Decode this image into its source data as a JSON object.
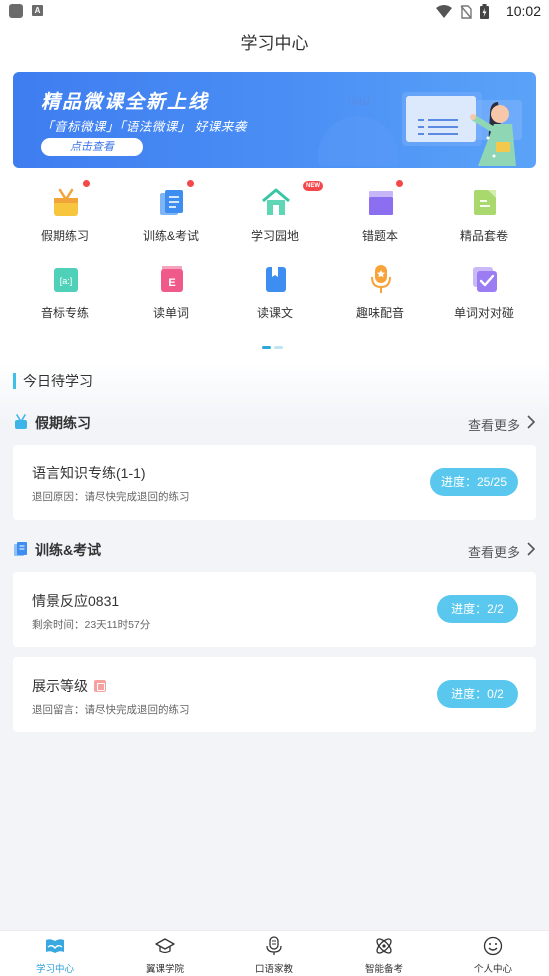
{
  "status_bar": {
    "time": "10:02",
    "notif_letter": "A"
  },
  "nav": {
    "title": "学习中心"
  },
  "banner": {
    "title": "精品微课全新上线",
    "subtitle": "「音标微课」「语法微课」 好课来袭",
    "button": "点击查看",
    "board_text": "/əʊ/"
  },
  "grid": {
    "row1": [
      {
        "label": "假期练习",
        "icon": "holiday-bag-icon",
        "badge": "dot"
      },
      {
        "label": "训练&考试",
        "icon": "training-book-icon",
        "badge": "dot"
      },
      {
        "label": "学习园地",
        "icon": "house-icon",
        "badge": "NEW"
      },
      {
        "label": "错题本",
        "icon": "mistakes-notebook-icon",
        "badge": "dot"
      },
      {
        "label": "精品套卷",
        "icon": "test-paper-icon",
        "badge": ""
      }
    ],
    "row2": [
      {
        "label": "音标专练",
        "icon": "phonetic-icon",
        "glyph": "[a:]"
      },
      {
        "label": "读单词",
        "icon": "read-words-icon",
        "glyph": "E"
      },
      {
        "label": "读课文",
        "icon": "read-text-icon"
      },
      {
        "label": "趣味配音",
        "icon": "microphone-icon"
      },
      {
        "label": "单词对对碰",
        "icon": "word-match-icon"
      }
    ]
  },
  "today": {
    "title": "今日待学习"
  },
  "sections": [
    {
      "title": "假期练习",
      "more": "查看更多",
      "cards": [
        {
          "title": "语言知识专练(1-1)",
          "sub": "退回原因：请尽快完成退回的练习",
          "progress": "进度：25/25"
        }
      ]
    },
    {
      "title": "训练&考试",
      "more": "查看更多",
      "cards": [
        {
          "title": "情景反应0831",
          "sub": "剩余时间：23天11时57分",
          "progress": "进度：2/2"
        },
        {
          "title": "展示等级",
          "sub": "退回留言：请尽快完成退回的练习",
          "progress": "进度：0/2"
        }
      ]
    }
  ],
  "tabbar": [
    {
      "label": "学习中心",
      "icon": "book-open-icon",
      "active": true
    },
    {
      "label": "翼课学院",
      "icon": "graduation-cap-icon"
    },
    {
      "label": "口语家教",
      "icon": "microphone-icon"
    },
    {
      "label": "智能备考",
      "icon": "atom-icon"
    },
    {
      "label": "个人中心",
      "icon": "smiley-face-icon"
    }
  ],
  "colors": {
    "accent": "#2d9fd8",
    "pill": "#5ac8ee",
    "badge_red": "#f5484a",
    "banner_blue": "#4b8ff5"
  }
}
